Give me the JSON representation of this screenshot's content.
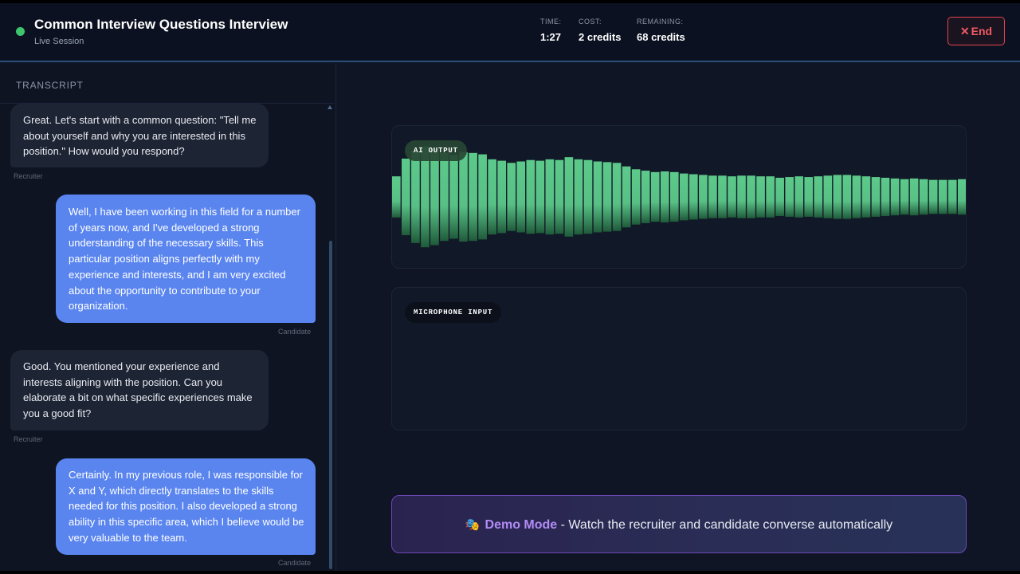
{
  "header": {
    "title": "Common Interview Questions Interview",
    "subtitle": "Live Session",
    "stats": [
      {
        "label": "TIME:",
        "value": "1:27"
      },
      {
        "label": "COST:",
        "value": "2 credits"
      },
      {
        "label": "REMAINING:",
        "value": "68 credits"
      }
    ],
    "end_label": "End",
    "end_icon": "close-icon"
  },
  "transcript": {
    "title": "TRANSCRIPT",
    "messages": [
      {
        "role": "Recruiter",
        "text": "Great. Let's start with a common question: \"Tell me about yourself and why you are interested in this position.\" How would you respond?"
      },
      {
        "role": "Candidate",
        "text": "Well, I have been working in this field for a number of years now, and I've developed a strong understanding of the necessary skills. This particular position aligns perfectly with my experience and interests, and I am very excited about the opportunity to contribute to your organization."
      },
      {
        "role": "Recruiter",
        "text": "Good. You mentioned your experience and interests aligning with the position. Can you elaborate a bit on what specific experiences make you a good fit?"
      },
      {
        "role": "Candidate",
        "text": "Certainly. In my previous role, I was responsible for X and Y, which directly translates to the skills needed for this position. I also developed a strong ability in this specific area, which I believe would be very valuable to the team."
      }
    ]
  },
  "ai_output": {
    "label": "AI OUTPUT",
    "bar_color": "#5cc98a",
    "levels": [
      0.29,
      0.54,
      0.65,
      0.71,
      0.68,
      0.62,
      0.59,
      0.63,
      0.62,
      0.6,
      0.53,
      0.51,
      0.48,
      0.5,
      0.52,
      0.51,
      0.53,
      0.52,
      0.56,
      0.53,
      0.52,
      0.5,
      0.49,
      0.48,
      0.43,
      0.39,
      0.37,
      0.35,
      0.36,
      0.35,
      0.33,
      0.32,
      0.31,
      0.3,
      0.3,
      0.29,
      0.3,
      0.3,
      0.29,
      0.29,
      0.27,
      0.28,
      0.29,
      0.28,
      0.29,
      0.3,
      0.31,
      0.31,
      0.3,
      0.29,
      0.28,
      0.27,
      0.26,
      0.25,
      0.26,
      0.25,
      0.24,
      0.24,
      0.24,
      0.25
    ]
  },
  "mic_input": {
    "label": "MICROPHONE INPUT"
  },
  "demo": {
    "icon": "masks-icon",
    "strong": "Demo Mode",
    "text": " - Watch the recruiter and candidate converse automatically"
  }
}
